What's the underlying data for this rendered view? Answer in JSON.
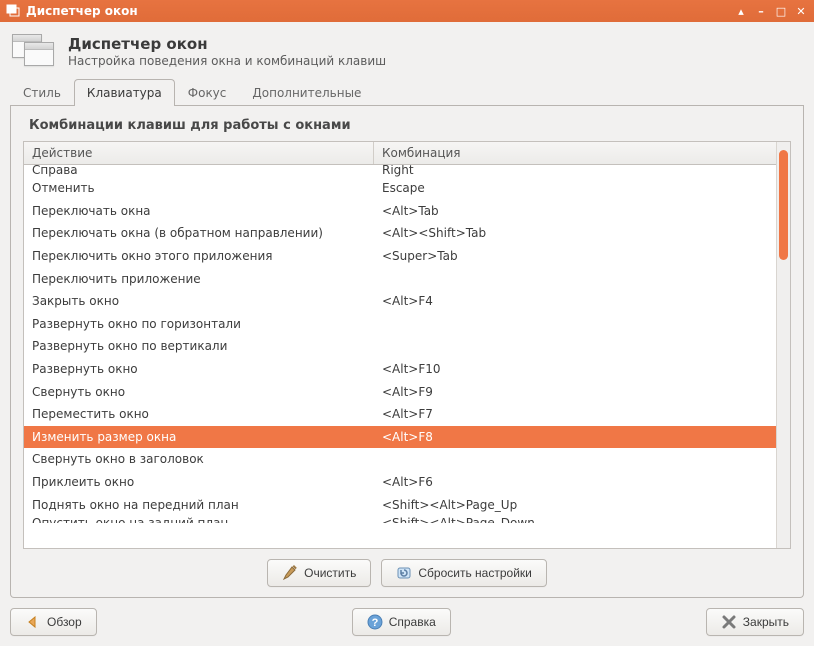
{
  "titlebar": {
    "title": "Диспетчер окон"
  },
  "header": {
    "title": "Диспетчер окон",
    "subtitle": "Настройка поведения окна и комбинаций клавиш"
  },
  "tabs": {
    "style": "Стиль",
    "keyboard": "Клавиатура",
    "focus": "Фокус",
    "advanced": "Дополнительные",
    "active": "keyboard"
  },
  "section_title": "Комбинации клавиш для работы с окнами",
  "columns": {
    "action": "Действие",
    "combo": "Комбинация"
  },
  "rows": [
    {
      "action": "Справа",
      "combo": "Right",
      "partial": "top"
    },
    {
      "action": "Отменить",
      "combo": "Escape"
    },
    {
      "action": "Переключать окна",
      "combo": "<Alt>Tab"
    },
    {
      "action": "Переключать окна (в обратном направлении)",
      "combo": "<Alt><Shift>Tab"
    },
    {
      "action": "Переключить окно этого приложения",
      "combo": "<Super>Tab"
    },
    {
      "action": "Переключить приложение",
      "combo": ""
    },
    {
      "action": "Закрыть окно",
      "combo": "<Alt>F4"
    },
    {
      "action": "Развернуть окно по горизонтали",
      "combo": ""
    },
    {
      "action": "Развернуть окно по вертикали",
      "combo": ""
    },
    {
      "action": "Развернуть окно",
      "combo": "<Alt>F10"
    },
    {
      "action": "Свернуть окно",
      "combo": "<Alt>F9"
    },
    {
      "action": "Переместить окно",
      "combo": "<Alt>F7"
    },
    {
      "action": "Изменить размер окна",
      "combo": "<Alt>F8",
      "selected": true
    },
    {
      "action": "Свернуть окно в заголовок",
      "combo": ""
    },
    {
      "action": "Приклеить окно",
      "combo": "<Alt>F6"
    },
    {
      "action": "Поднять окно на передний план",
      "combo": "<Shift><Alt>Page_Up"
    },
    {
      "action": "Опустить окно на задний план",
      "combo": "<Shift><Alt>Page_Down",
      "partial": "bottom"
    }
  ],
  "buttons": {
    "clear": "Очистить",
    "reset": "Сбросить настройки",
    "overview": "Обзор",
    "help": "Справка",
    "close": "Закрыть"
  }
}
